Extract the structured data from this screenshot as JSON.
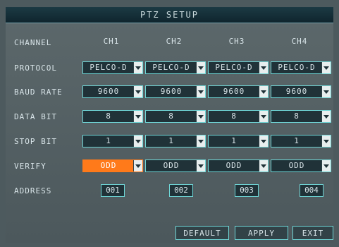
{
  "title": "PTZ SETUP",
  "labels": {
    "channel": "CHANNEL",
    "protocol": "PROTOCOL",
    "baud_rate": "BAUD RATE",
    "data_bit": "DATA BIT",
    "stop_bit": "STOP BIT",
    "verify": "VERIFY",
    "address": "ADDRESS"
  },
  "channels": [
    {
      "name": "CH1",
      "protocol": "PELCO-D",
      "baud": "9600",
      "data_bit": "8",
      "stop_bit": "1",
      "verify": "ODD",
      "address": "001"
    },
    {
      "name": "CH2",
      "protocol": "PELCO-D",
      "baud": "9600",
      "data_bit": "8",
      "stop_bit": "1",
      "verify": "ODD",
      "address": "002"
    },
    {
      "name": "CH3",
      "protocol": "PELCO-D",
      "baud": "9600",
      "data_bit": "8",
      "stop_bit": "1",
      "verify": "ODD",
      "address": "003"
    },
    {
      "name": "CH4",
      "protocol": "PELCO-D",
      "baud": "9600",
      "data_bit": "8",
      "stop_bit": "1",
      "verify": "ODD",
      "address": "004"
    }
  ],
  "buttons": {
    "default": "DEFAULT",
    "apply": "APPLY",
    "exit": "EXIT"
  },
  "colors": {
    "accent_selected": "#ff7a1a",
    "border": "#6fd6d6"
  }
}
